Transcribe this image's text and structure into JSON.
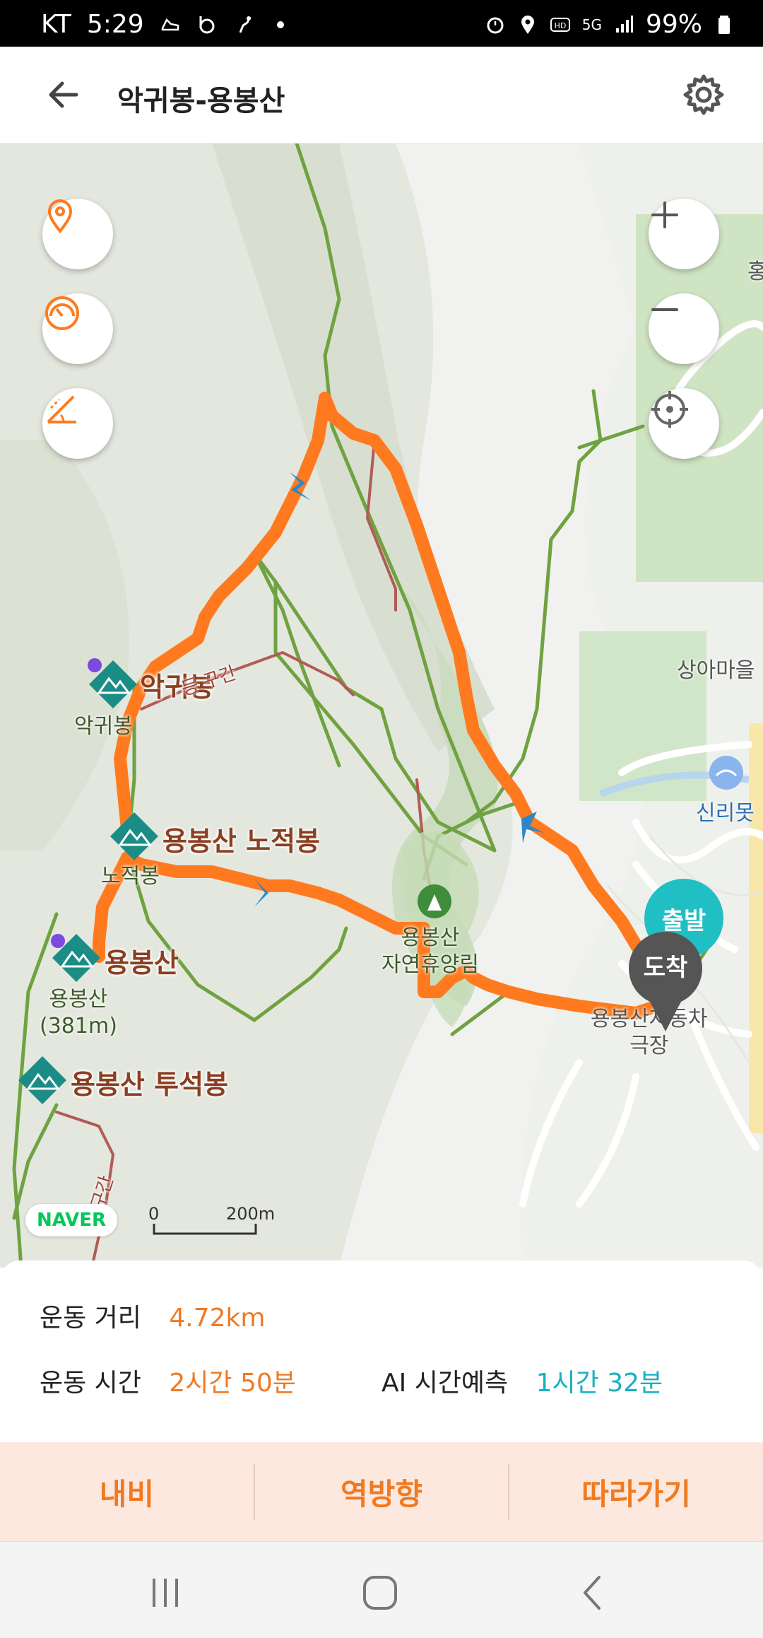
{
  "status": {
    "carrier": "KT",
    "time": "5:29",
    "network": "5G",
    "battery": "99%"
  },
  "header": {
    "title": "악귀봉-용봉산",
    "back_icon": "arrow-left-icon",
    "settings_icon": "gear-icon"
  },
  "map": {
    "labels": {
      "peak1": "악귀봉",
      "peak1_sub": "악귀봉",
      "peak2": "용봉산 노적봉",
      "peak2_sub": "노적봉",
      "peak3": "용봉산",
      "peak3_sub": "용봉산\n(381m)",
      "peak4": "용봉산 투석봉",
      "forest": "용봉산\n자연휴양림",
      "village": "상아마을",
      "pond": "신리못",
      "parking": "용봉산자동차\n극장",
      "segment1": "등 구간",
      "segment2": "등 구간",
      "edge_char": "홍"
    },
    "start_label": "출발",
    "end_label": "도착",
    "naver": "NAVER",
    "scale_zero": "0",
    "scale_value": "200m",
    "controls": [
      "location-pin-icon",
      "speedometer-icon",
      "incline-icon",
      "zoom-in-icon",
      "zoom-out-icon",
      "crosshair-icon"
    ]
  },
  "summary": {
    "distance_label": "운동 거리",
    "distance_value": "4.72km",
    "time_label": "운동 시간",
    "time_value": "2시간 50분",
    "ai_label": "AI 시간예측",
    "ai_value": "1시간 32분"
  },
  "actions": {
    "navi": "내비",
    "reverse": "역방향",
    "follow": "따라가기"
  },
  "colors": {
    "route": "#ff7a1f",
    "trail": "#6fa240",
    "accent": "#f07a22",
    "teal": "#1ab0bf"
  }
}
